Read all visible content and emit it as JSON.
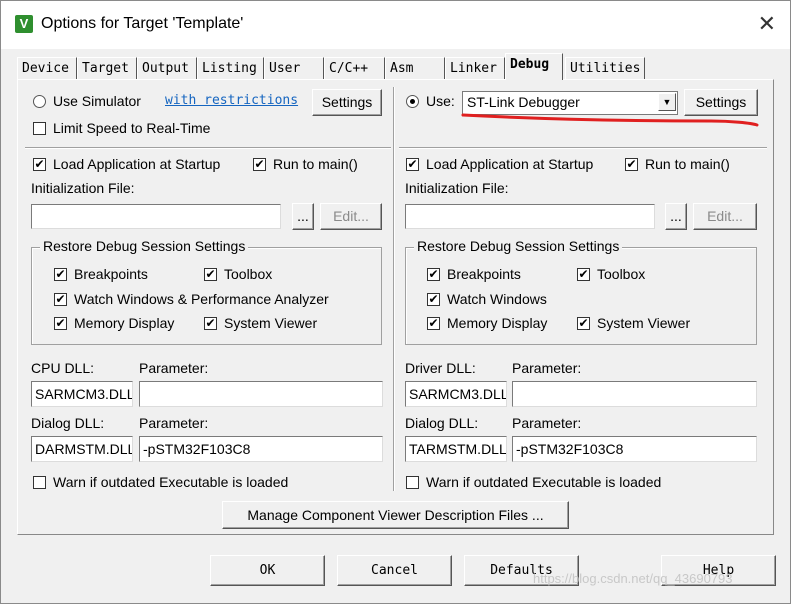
{
  "window": {
    "title": "Options for Target 'Template'",
    "close_glyph": "✕"
  },
  "tabs": [
    {
      "label": "Device"
    },
    {
      "label": "Target"
    },
    {
      "label": "Output"
    },
    {
      "label": "Listing"
    },
    {
      "label": "User"
    },
    {
      "label": "C/C++"
    },
    {
      "label": "Asm"
    },
    {
      "label": "Linker"
    },
    {
      "label": "Debug",
      "active": true
    },
    {
      "label": "Utilities"
    }
  ],
  "left": {
    "use_simulator_label": "Use Simulator",
    "restrictions_link": "with restrictions",
    "settings_button": "Settings",
    "limit_speed_label": "Limit Speed to Real-Time",
    "load_app_label": "Load Application at Startup",
    "run_to_main_label": "Run to main()",
    "init_file_label": "Initialization File:",
    "init_file_value": "",
    "browse_button": "...",
    "edit_button": "Edit...",
    "restore_group_title": "Restore Debug Session Settings",
    "breakpoints_label": "Breakpoints",
    "toolbox_label": "Toolbox",
    "watch_label": "Watch Windows & Performance Analyzer",
    "memory_label": "Memory Display",
    "system_viewer_label": "System Viewer",
    "cpu_dll_label": "CPU DLL:",
    "cpu_param_label": "Parameter:",
    "cpu_dll_value": "SARMCM3.DLL",
    "cpu_param_value": "",
    "dialog_dll_label": "Dialog DLL:",
    "dialog_param_label": "Parameter:",
    "dialog_dll_value": "DARMSTM.DLL",
    "dialog_param_value": "-pSTM32F103C8",
    "warn_label": "Warn if outdated Executable is loaded"
  },
  "right": {
    "use_label": "Use:",
    "debugger_value": "ST-Link Debugger",
    "settings_button": "Settings",
    "load_app_label": "Load Application at Startup",
    "run_to_main_label": "Run to main()",
    "init_file_label": "Initialization File:",
    "init_file_value": "",
    "browse_button": "...",
    "edit_button": "Edit...",
    "restore_group_title": "Restore Debug Session Settings",
    "breakpoints_label": "Breakpoints",
    "toolbox_label": "Toolbox",
    "watch_label": "Watch Windows",
    "memory_label": "Memory Display",
    "system_viewer_label": "System Viewer",
    "driver_dll_label": "Driver DLL:",
    "driver_param_label": "Parameter:",
    "driver_dll_value": "SARMCM3.DLL",
    "driver_param_value": "",
    "dialog_dll_label": "Dialog DLL:",
    "dialog_param_label": "Parameter:",
    "dialog_dll_value": "TARMSTM.DLL",
    "dialog_param_value": "-pSTM32F103C8",
    "warn_label": "Warn if outdated Executable is loaded"
  },
  "manage_button": "Manage Component Viewer Description Files ...",
  "footer": {
    "ok": "OK",
    "cancel": "Cancel",
    "defaults": "Defaults",
    "help": "Help"
  },
  "check_glyph": "✔",
  "watermark": "https://blog.csdn.net/qq_43690793",
  "colors": {
    "annotation_red": "#e02020",
    "link_blue": "#1565c0"
  }
}
